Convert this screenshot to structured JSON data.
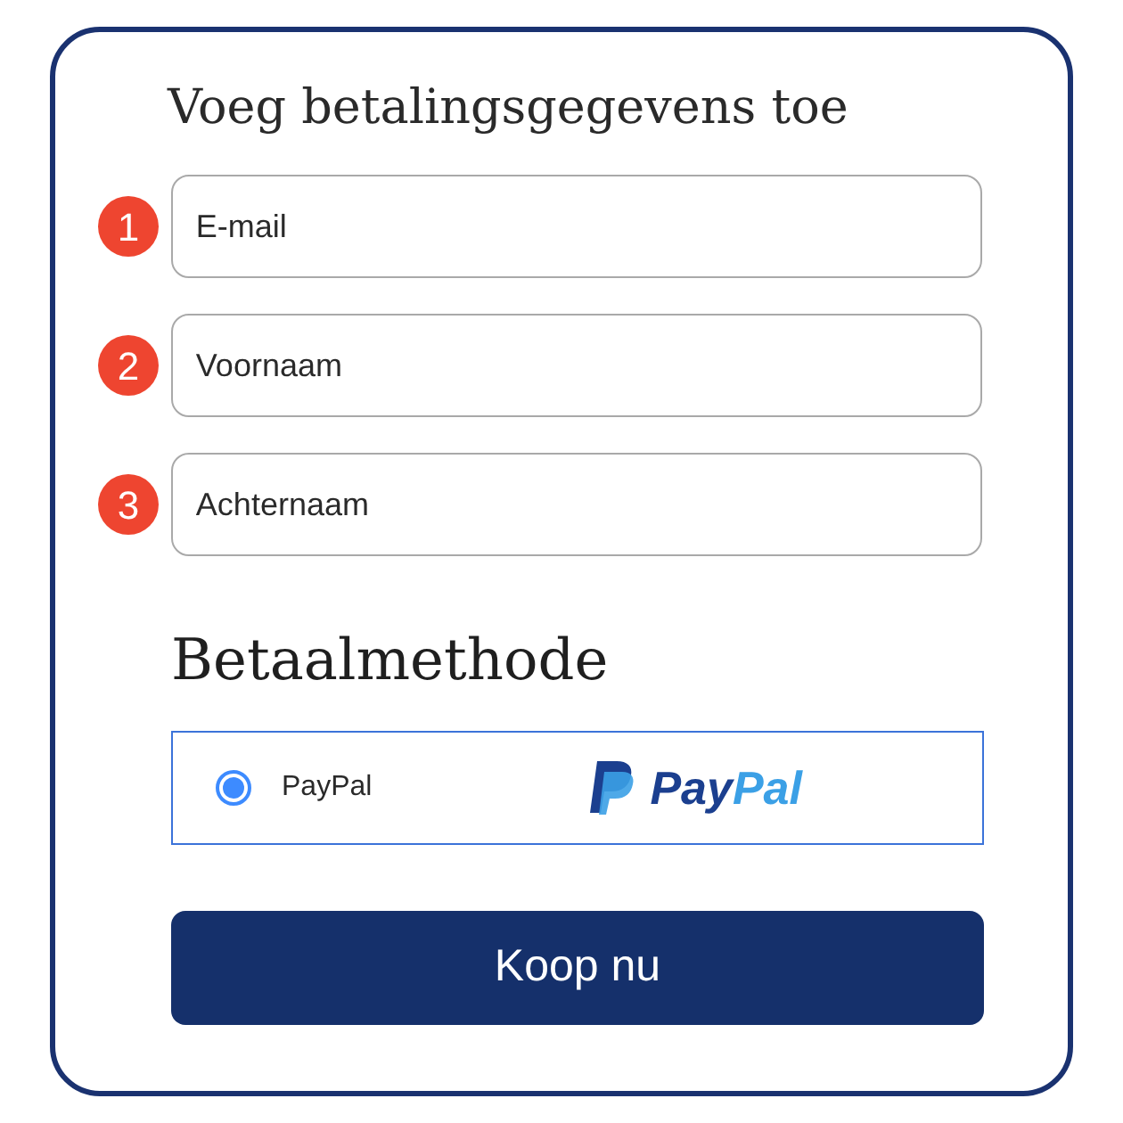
{
  "form": {
    "title": "Voeg betalingsgegevens toe",
    "fields": [
      {
        "number": "1",
        "placeholder": "E-mail"
      },
      {
        "number": "2",
        "placeholder": "Voornaam"
      },
      {
        "number": "3",
        "placeholder": "Achternaam"
      }
    ]
  },
  "payment": {
    "title": "Betaalmethode",
    "options": [
      {
        "label": "PayPal",
        "selected": true,
        "logo": {
          "part_1": "Pay",
          "part_2": "Pal"
        }
      }
    ]
  },
  "buy_button": "Koop nu"
}
